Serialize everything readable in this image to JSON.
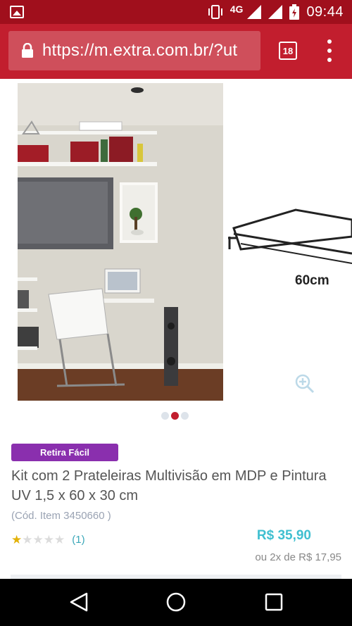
{
  "status_bar": {
    "network": "4G",
    "time": "09:44"
  },
  "browser": {
    "url": "https://m.extra.com.br/?ut",
    "tab_count": "18"
  },
  "gallery": {
    "next_slide_label": "60cm",
    "slide_count": 3,
    "active_index": 1
  },
  "product": {
    "badge": "Retira Fácil",
    "title": "Kit com 2 Prateleiras Multivisão em MDP e Pintura UV 1,5 x 60 x 30 cm",
    "code": "(Cód. Item 3450660 )",
    "rating": 1,
    "rating_max": 5,
    "review_count": "(1)",
    "price": "R$ 35,90",
    "installments": "ou 2x de R$ 17,95"
  },
  "colors": {
    "status_bar": "#a00f1c",
    "toolbar": "#c21e2e",
    "badge": "#8a2fae",
    "price": "#3fbfd0",
    "star": "#e3b20a"
  }
}
